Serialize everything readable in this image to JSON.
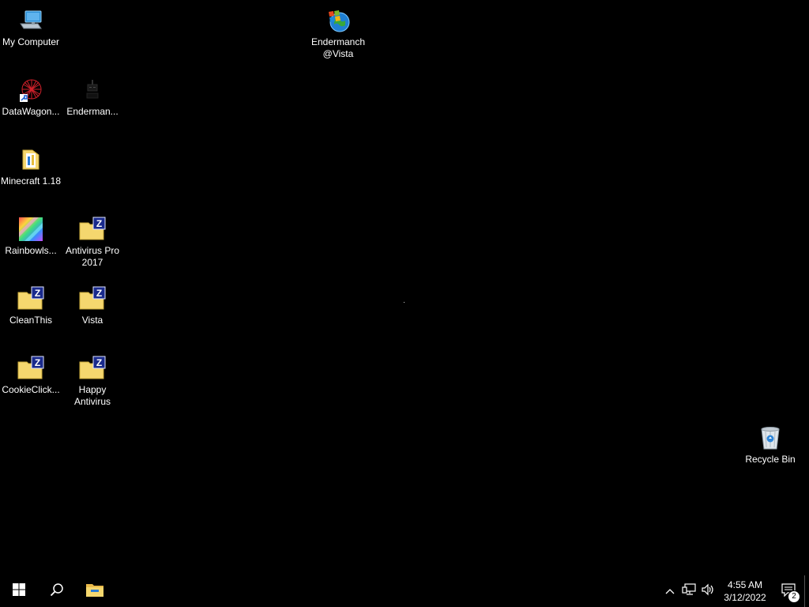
{
  "desktop": {
    "icons": [
      {
        "name": "my-computer",
        "label": "My Computer"
      },
      {
        "name": "endermanch-vista",
        "label": "Endermanch @Vista"
      },
      {
        "name": "datawagon",
        "label": "DataWagon..."
      },
      {
        "name": "endermanch-shortcut",
        "label": "Enderman..."
      },
      {
        "name": "minecraft",
        "label": "Minecraft 1.18"
      },
      {
        "name": "rainbowls",
        "label": "Rainbowls..."
      },
      {
        "name": "antivirus-pro-2017",
        "label": "Antivirus Pro 2017"
      },
      {
        "name": "cleanthis",
        "label": "CleanThis"
      },
      {
        "name": "vista",
        "label": "Vista"
      },
      {
        "name": "cookieclick",
        "label": "CookieClick..."
      },
      {
        "name": "happy-antivirus",
        "label": "Happy Antivirus"
      },
      {
        "name": "recycle-bin",
        "label": "Recycle Bin"
      }
    ]
  },
  "taskbar": {
    "clock": {
      "time": "4:55 AM",
      "date": "3/12/2022"
    },
    "notifications": {
      "count": "2"
    }
  },
  "colors": {
    "background": "#000000",
    "folder": "#f5d76e",
    "zip_badge": "#1a2a8c"
  }
}
